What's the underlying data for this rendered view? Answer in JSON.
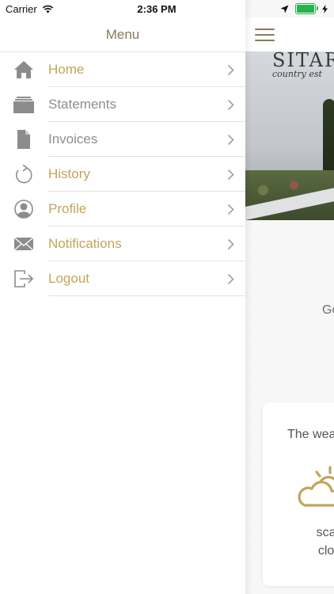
{
  "status_bar": {
    "carrier": "Carrier",
    "time": "2:36 PM",
    "battery_level": 1.0
  },
  "menu": {
    "title": "Menu",
    "items": [
      {
        "label": "Home",
        "icon": "home-icon",
        "color": "#c3a45a"
      },
      {
        "label": "Statements",
        "icon": "statements-icon",
        "color": "#8e8e8e"
      },
      {
        "label": "Invoices",
        "icon": "document-icon",
        "color": "#8e8e8e"
      },
      {
        "label": "History",
        "icon": "refresh-icon",
        "color": "#c3a45a"
      },
      {
        "label": "Profile",
        "icon": "profile-icon",
        "color": "#c3a45a"
      },
      {
        "label": "Notifications",
        "icon": "envelope-icon",
        "color": "#c3a45a"
      },
      {
        "label": "Logout",
        "icon": "logout-icon",
        "color": "#c3a45a"
      }
    ]
  },
  "main": {
    "hero": {
      "sign_text": "SITAR",
      "sign_subtext": "country est"
    },
    "greeting": "Go",
    "weather": {
      "title": "The wea",
      "icon": "partly-cloudy-icon",
      "description_line1": "scatte",
      "description_line2": "cloud"
    }
  },
  "colors": {
    "accent_gold": "#c3a45a",
    "menu_title": "#8a7a56",
    "muted_grey": "#8e8e8e",
    "battery_green": "#2bb24c"
  }
}
